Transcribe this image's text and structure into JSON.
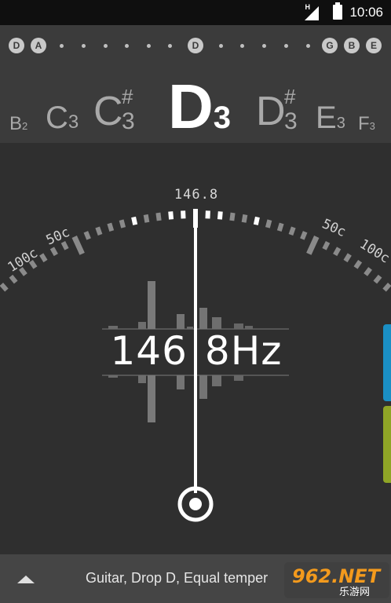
{
  "status_bar": {
    "time": "10:06",
    "network_badge": "H",
    "icons": [
      "signal-icon",
      "battery-icon"
    ]
  },
  "strings": [
    "D",
    "A",
    "D",
    "G",
    "B",
    "E"
  ],
  "notes": [
    {
      "letter": "B",
      "octave": "2"
    },
    {
      "letter": "C",
      "octave": "3"
    },
    {
      "letter": "C",
      "sharp": "#",
      "octave": "3"
    },
    {
      "letter": "D",
      "octave": "3"
    },
    {
      "letter": "D",
      "sharp": "#",
      "octave": "3"
    },
    {
      "letter": "E",
      "octave": "3"
    },
    {
      "letter": "F",
      "octave": "3"
    }
  ],
  "tuner": {
    "reference_frequency": "146.8",
    "frequency_readout_left": "146",
    "frequency_readout_right": "8Hz",
    "scale_left_outer": "100c",
    "scale_left_inner": "50c",
    "scale_right_inner": "50c",
    "scale_right_outer": "100c",
    "cents_offset": 0
  },
  "bottom_bar": {
    "preset": "Guitar, Drop D, Equal temper",
    "expand_icon": "up-arrow-icon"
  },
  "watermark": {
    "brand": "962.NET",
    "sub": "乐游网"
  },
  "colors": {
    "background": "#2f2f2f",
    "note_strip": "#3b3b3b",
    "accent_blue": "#1a8fc4",
    "accent_green": "#8fa526"
  }
}
